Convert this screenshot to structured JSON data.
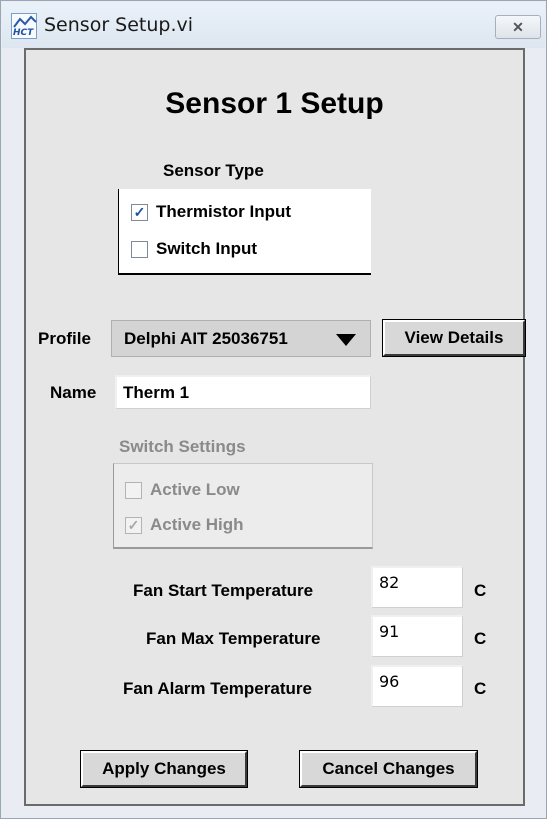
{
  "window": {
    "title": "Sensor Setup.vi",
    "icon_text": "HCT",
    "close_glyph": "✕"
  },
  "page_title": "Sensor 1 Setup",
  "sensor_type": {
    "heading": "Sensor Type",
    "options": [
      {
        "label": "Thermistor Input",
        "checked": true
      },
      {
        "label": "Switch Input",
        "checked": false
      }
    ]
  },
  "profile": {
    "label": "Profile",
    "selected": "Delphi AIT 25036751",
    "view_details_label": "View Details"
  },
  "name": {
    "label": "Name",
    "value": "Therm 1"
  },
  "switch_settings": {
    "heading": "Switch Settings",
    "options": [
      {
        "label": "Active Low",
        "checked": false
      },
      {
        "label": "Active High",
        "checked": true
      }
    ]
  },
  "temperatures": [
    {
      "label": "Fan Start Temperature",
      "value": "82",
      "unit": "C"
    },
    {
      "label": "Fan Max Temperature",
      "value": "91",
      "unit": "C"
    },
    {
      "label": "Fan Alarm Temperature",
      "value": "96",
      "unit": "C"
    }
  ],
  "actions": {
    "apply_label": "Apply Changes",
    "cancel_label": "Cancel Changes"
  }
}
